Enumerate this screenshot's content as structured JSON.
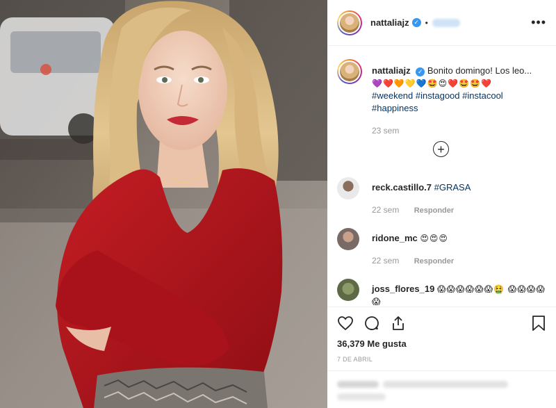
{
  "post": {
    "username": "nattaliajz",
    "verified_badge": "✓",
    "header_separator": "•",
    "more_label": "•••"
  },
  "caption": {
    "username": "nattaliajz",
    "text": "Bonito domingo! Los leo...",
    "emojis": "💜❤️🧡💛💙🤩😍❤️🤩🤩❤️",
    "hashtags": [
      "#weekend",
      "#instagood",
      "#instacool",
      "#happiness"
    ],
    "time": "23 sem"
  },
  "load_more_label": "+",
  "comments": [
    {
      "username": "reck.castillo.7",
      "text": "#GRASA",
      "time": "22 sem",
      "reply": "Responder"
    },
    {
      "username": "ridone_mc",
      "text": "😍😍😍",
      "time": "22 sem",
      "reply": "Responder"
    },
    {
      "username": "joss_flores_19",
      "text": "😱😱😱😱😱😱🤮 😱😱😱😱😱",
      "time": "",
      "reply": ""
    }
  ],
  "actions": {
    "likes": "36,379 Me gusta",
    "date": "7 DE ABRIL"
  },
  "colors": {
    "hashtag": "#003569",
    "muted": "#999999",
    "verified": "#3897f0",
    "sweater": "#b3161d"
  },
  "icons": [
    "heart-icon",
    "comment-icon",
    "share-icon",
    "bookmark-icon",
    "more-options-icon",
    "plus-circle-icon",
    "verified-icon"
  ]
}
